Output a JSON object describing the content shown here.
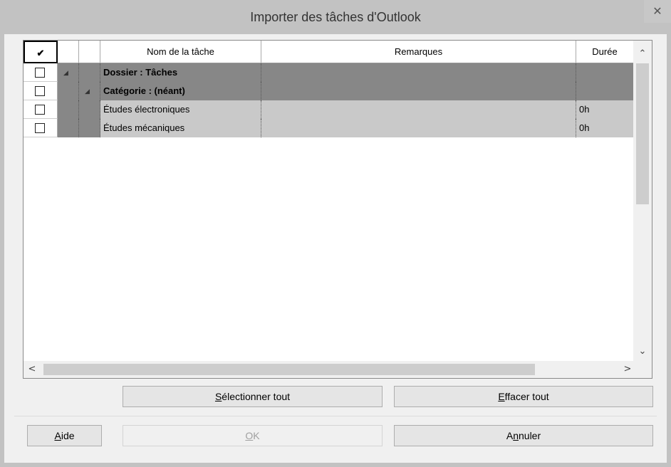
{
  "window": {
    "title": "Importer des tâches d'Outlook",
    "close_glyph": "✕"
  },
  "grid": {
    "columns": {
      "check": "✔",
      "name": "Nom de la tâche",
      "remarks": "Remarques",
      "duration": "Durée"
    },
    "rows": [
      {
        "type": "summary",
        "level": 1,
        "name": "Dossier : Tâches",
        "remarks": "",
        "duration": "",
        "checked": false
      },
      {
        "type": "summary",
        "level": 2,
        "name": "Catégorie : (néant)",
        "remarks": "",
        "duration": "",
        "checked": false
      },
      {
        "type": "task",
        "level": 3,
        "name": "Études électroniques",
        "remarks": "",
        "duration": "0h",
        "checked": false
      },
      {
        "type": "task",
        "level": 3,
        "name": "Études mécaniques",
        "remarks": "",
        "duration": "0h",
        "checked": false
      }
    ],
    "collapse_glyph": "◢",
    "scroll": {
      "up": "⌃",
      "down": "⌄",
      "left": "<",
      "right": ">"
    }
  },
  "buttons": {
    "select_all": {
      "pre": "",
      "acc": "S",
      "post": "électionner tout"
    },
    "clear_all": {
      "pre": "",
      "acc": "E",
      "post": "ffacer tout"
    },
    "help": {
      "pre": "",
      "acc": "A",
      "post": "ide"
    },
    "ok": {
      "pre": "",
      "acc": "O",
      "post": "K"
    },
    "cancel": {
      "pre": "A",
      "acc": "n",
      "post": "nuler"
    }
  }
}
